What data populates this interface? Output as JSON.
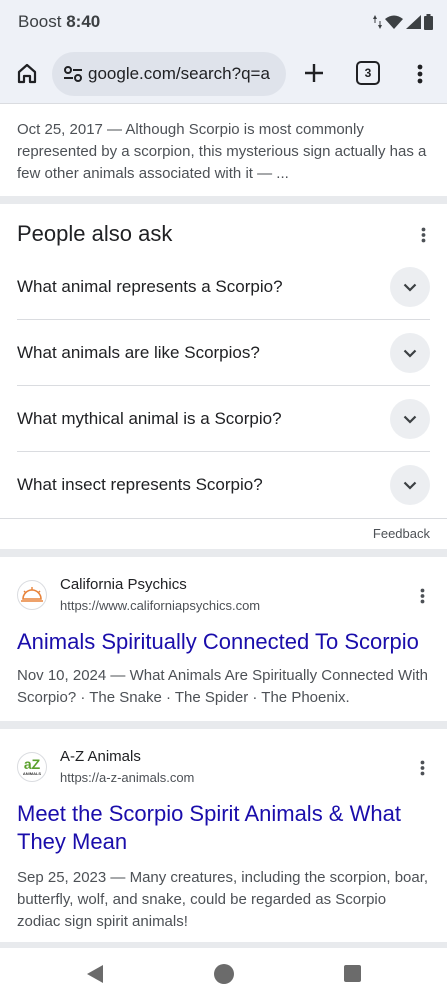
{
  "status_bar": {
    "carrier": "Boost",
    "time": "8:40"
  },
  "toolbar": {
    "url": "google.com/search?q=a",
    "tab_count": "3"
  },
  "snippet_top": "Oct 25, 2017 — Although Scorpio is most commonly represented by a scorpion, this mysterious sign actually has a few other animals associated with it — ...",
  "paa": {
    "title": "People also ask",
    "questions": [
      "What animal represents a Scorpio?",
      "What animals are like Scorpios?",
      "What mythical animal is a Scorpio?",
      "What insect represents Scorpio?"
    ],
    "feedback": "Feedback"
  },
  "results": [
    {
      "site_name": "California Psychics",
      "site_url": "https://www.californiapsychics.com",
      "title": "Animals Spiritually Connected To Scorpio",
      "snippet": "Nov 10, 2024 — What Animals Are Spiritually Connected With Scorpio? · The Snake · The Spider · The Phoenix."
    },
    {
      "site_name": "A-Z Animals",
      "site_url": "https://a-z-animals.com",
      "logo_text": "aZ",
      "logo_subtext": "ANIMALS",
      "title": "Meet the Scorpio Spirit Animals & What They Mean",
      "snippet": "Sep 25, 2023 — Many creatures, including the scorpion, boar, butterfly, wolf, and snake, could be regarded as Scorpio zodiac sign spirit animals!"
    }
  ],
  "colors": {
    "link": "#1a0dab",
    "chrome_bg": "#eef1f7",
    "logo_orange": "#e8833a",
    "logo_green": "#5aa02c"
  }
}
